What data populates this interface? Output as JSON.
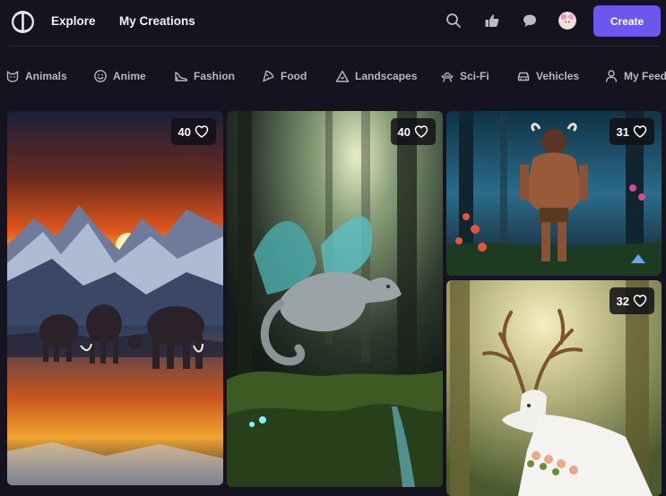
{
  "header": {
    "nav": {
      "explore": "Explore",
      "my_creations": "My Creations"
    },
    "create_label": "Create",
    "icons": [
      "search-icon",
      "thumbs-up-icon",
      "chat-bubble-icon"
    ],
    "accent_color": "#6b56ee"
  },
  "categories": [
    {
      "label": "Animals",
      "icon": "cat-face-icon"
    },
    {
      "label": "Anime",
      "icon": "smiley-icon"
    },
    {
      "label": "Fashion",
      "icon": "high-heel-icon"
    },
    {
      "label": "Food",
      "icon": "pizza-slice-icon"
    },
    {
      "label": "Landscapes",
      "icon": "mountain-icon"
    },
    {
      "label": "Sci-Fi",
      "icon": "ufo-icon"
    },
    {
      "label": "Vehicles",
      "icon": "car-icon"
    },
    {
      "label": "My Feed",
      "icon": "user-icon"
    }
  ],
  "gallery": [
    {
      "subject": "mammoths-at-sunset",
      "likes": "40"
    },
    {
      "subject": "dragon-in-forest",
      "likes": "40"
    },
    {
      "subject": "minotaur-in-forest",
      "likes": "31"
    },
    {
      "subject": "white-stag-in-forest",
      "likes": "32"
    }
  ]
}
